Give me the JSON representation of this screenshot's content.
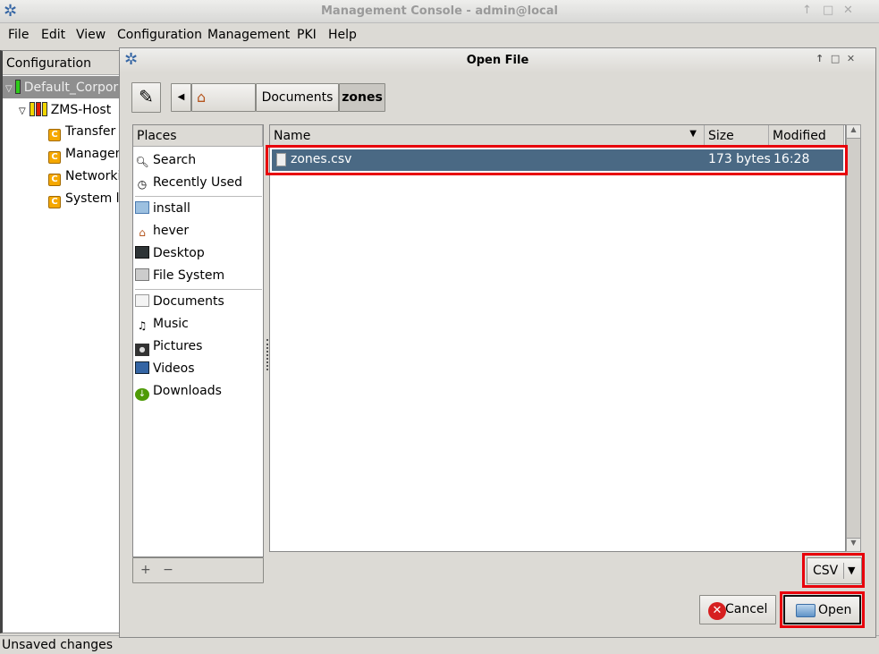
{
  "window": {
    "title": "Management Console - admin@local",
    "controls": [
      "↑",
      "□",
      "✕"
    ]
  },
  "menu": [
    "File",
    "Edit",
    "View",
    "Configuration",
    "Management",
    "PKI",
    "Help"
  ],
  "tree": {
    "header": "Configuration",
    "items": [
      "Default_Corporate",
      "ZMS-Host",
      "Transfer Agent",
      "Management",
      "Networking",
      "System logging"
    ]
  },
  "status": "Unsaved changes",
  "dialog": {
    "title": "Open File",
    "path": [
      "Documents",
      "zones"
    ],
    "places_header": "Places",
    "places": [
      [
        "Search",
        "Recently Used"
      ],
      [
        "install",
        "hever",
        "Desktop",
        "File System"
      ],
      [
        "Documents",
        "Music",
        "Pictures",
        "Videos",
        "Downloads"
      ]
    ],
    "add": "+",
    "remove": "−",
    "columns": {
      "name": "Name",
      "size": "Size",
      "modified": "Modified"
    },
    "files": [
      {
        "name": "zones.csv",
        "size": "173 bytes",
        "modified": "16:28"
      }
    ],
    "filter": "CSV",
    "cancel": "Cancel",
    "open": "Open"
  },
  "colors": {
    "selection": "#4a6984",
    "highlight": "#e8000b"
  }
}
